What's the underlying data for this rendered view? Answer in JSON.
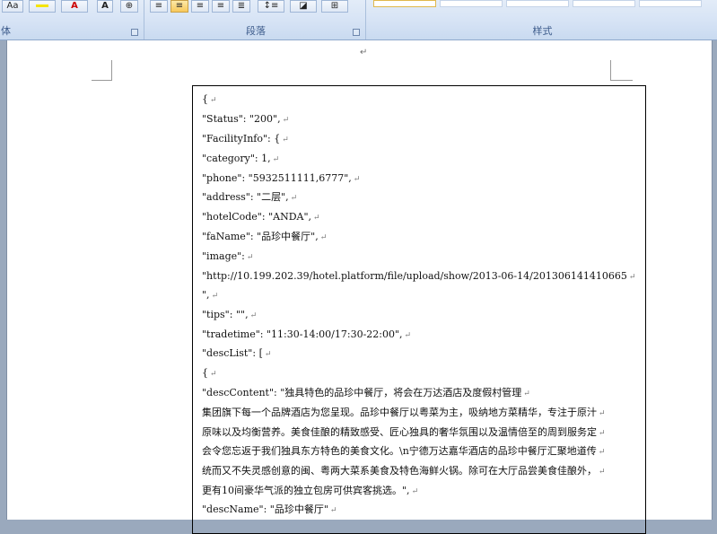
{
  "ribbon": {
    "font_group_label": "体",
    "paragraph_group_label": "段落",
    "styles_group_label": "样式",
    "buttons": {
      "change_case": "Aa",
      "font_color": "A",
      "char_shading": "A"
    }
  },
  "paragraph_mark": "↵",
  "document": {
    "lines": [
      "{",
      "    \"Status\": \"200\",",
      "    \"FacilityInfo\": {",
      "        \"category\": 1,",
      "        \"phone\": \"5932511111,6777\",",
      "        \"address\": \"二层\",",
      "        \"hotelCode\": \"ANDA\",",
      "        \"faName\": \"品珍中餐厅\",",
      "        \"image\":",
      "\"http://10.199.202.39/hotel.platform/file/upload/show/2013-06-14/201306141410665",
      "\",",
      "        \"tips\": \"\",",
      "        \"tradetime\": \"11:30-14:00/17:30-22:00\",",
      "        \"descList\": [",
      "            {",
      "                \"descContent\": \"独具特色的品珍中餐厅，将会在万达酒店及度假村管理",
      "集团旗下每一个品牌酒店为您呈现。品珍中餐厅以粤菜为主，吸纳地方菜精华，专注于原汁",
      "原味以及均衡营养。美食佳酿的精致感受、匠心独具的奢华氛围以及温情倍至的周到服务定",
      "会令您忘返于我们独具东方特色的美食文化。\\n宁德万达嘉华酒店的品珍中餐厅汇聚地道传",
      "统而又不失灵感创意的闽、粤两大菜系美食及特色海鲜火锅。除可在大厅品尝美食佳酿外，",
      "更有10间豪华气派的独立包房可供宾客挑选。\",",
      "                \"descName\": \"品珍中餐厅\""
    ]
  }
}
